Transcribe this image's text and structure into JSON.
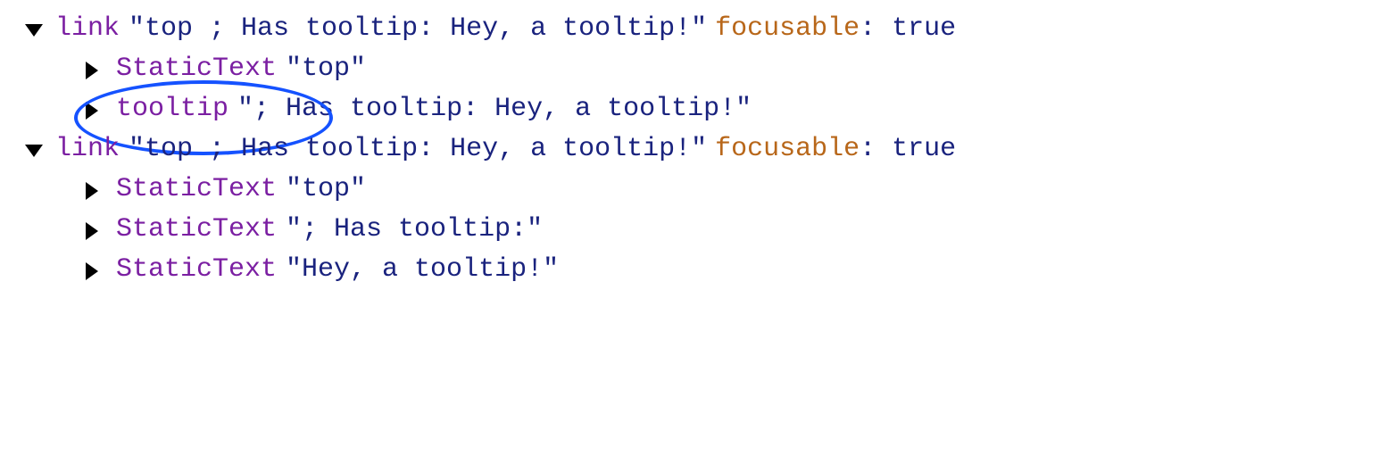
{
  "tree": [
    {
      "indent": 0,
      "expanded": true,
      "role": "link",
      "name": "\"top ; Has tooltip: Hey, a tooltip!\"",
      "attrKey": "focusable",
      "attrVal": ": true",
      "circled": false
    },
    {
      "indent": 1,
      "expanded": false,
      "role": "StaticText",
      "name": "\"top\"",
      "circled": false
    },
    {
      "indent": 1,
      "expanded": false,
      "role": "tooltip",
      "name": "\"; Has tooltip: Hey, a tooltip!\"",
      "circled": true
    },
    {
      "indent": 0,
      "expanded": true,
      "role": "link",
      "name": "\"top ; Has tooltip: Hey, a tooltip!\"",
      "attrKey": "focusable",
      "attrVal": ": true",
      "circled": false
    },
    {
      "indent": 1,
      "expanded": false,
      "role": "StaticText",
      "name": "\"top\"",
      "circled": false
    },
    {
      "indent": 1,
      "expanded": false,
      "role": "StaticText",
      "name": "\"; Has tooltip:\"",
      "circled": false
    },
    {
      "indent": 1,
      "expanded": false,
      "role": "StaticText",
      "name": "\"Hey, a tooltip!\"",
      "circled": false
    }
  ]
}
